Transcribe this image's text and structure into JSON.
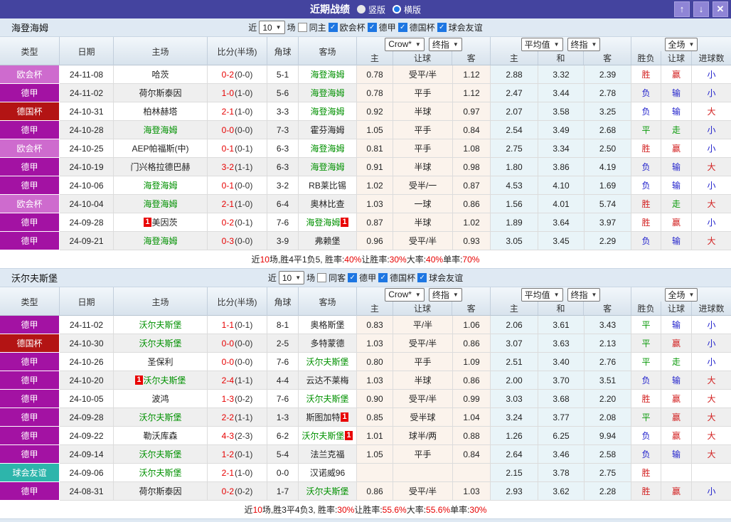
{
  "titlebar": {
    "title": "近期战绩",
    "vertical_label": "竖版",
    "horizontal_label": "横版",
    "up_icon": "↑",
    "down_icon": "↓",
    "close_icon": "✕"
  },
  "controls": {
    "recent_label": "近",
    "recent_value": "10",
    "games_label": "场"
  },
  "columns": {
    "type": "类型",
    "date": "日期",
    "home": "主场",
    "score": "比分(半场)",
    "corner": "角球",
    "away": "客场",
    "odds_home": "主",
    "odds_handicap": "让球",
    "odds_away": "客",
    "avg_home": "主",
    "avg_draw": "和",
    "avg_away": "客",
    "result": "胜负",
    "handicap_result": "让球",
    "goals": "进球数"
  },
  "colors": {
    "titlebar_bg": "#44449f",
    "accent_blue": "#1d76e2",
    "score_red": "#e60000",
    "team_green": "#009100",
    "summary_red": "#e60000",
    "types": {
      "欧会杯": "#ce6bce",
      "德甲": "#a312a3",
      "德国杯": "#b31414",
      "球会友谊": "#2db5ab"
    },
    "outcomes": {
      "胜": "#d21f1f",
      "负": "#2222cc",
      "平": "#0a9a0a",
      "赢": "#d21f1f",
      "输": "#2222cc",
      "走": "#0a9a0a",
      "大": "#d21f1f",
      "小": "#2222cc"
    }
  },
  "tables": [
    {
      "team": "海登海姆",
      "same_filter": "同主",
      "same_checked": false,
      "leagues": [
        "欧会杯",
        "德甲",
        "德国杯",
        "球会友谊"
      ],
      "selects": {
        "odds_source": "Crow*",
        "odds_kind": "终指",
        "avg_source": "平均值",
        "avg_kind": "终指",
        "scope": "全场"
      },
      "rows": [
        {
          "type": "欧会杯",
          "date": "24-11-08",
          "home": "哈茨",
          "home_green": false,
          "home_rc": false,
          "ft": "0-2",
          "ht": "(0-0)",
          "corner": "5-1",
          "away": "海登海姆",
          "away_green": true,
          "away_rc": false,
          "odds": [
            "0.78",
            "受平/半",
            "1.12"
          ],
          "avg": [
            "2.88",
            "3.32",
            "2.39"
          ],
          "result": "胜",
          "hcp": "赢",
          "goals": "小"
        },
        {
          "type": "德甲",
          "date": "24-11-02",
          "home": "荷尔斯泰因",
          "home_green": false,
          "home_rc": false,
          "ft": "1-0",
          "ht": "(1-0)",
          "corner": "5-6",
          "away": "海登海姆",
          "away_green": true,
          "away_rc": false,
          "odds": [
            "0.78",
            "平手",
            "1.12"
          ],
          "avg": [
            "2.47",
            "3.44",
            "2.78"
          ],
          "result": "负",
          "hcp": "输",
          "goals": "小"
        },
        {
          "type": "德国杯",
          "date": "24-10-31",
          "home": "柏林赫塔",
          "home_green": false,
          "home_rc": false,
          "ft": "2-1",
          "ht": "(1-0)",
          "corner": "3-3",
          "away": "海登海姆",
          "away_green": true,
          "away_rc": false,
          "odds": [
            "0.92",
            "半球",
            "0.97"
          ],
          "avg": [
            "2.07",
            "3.58",
            "3.25"
          ],
          "result": "负",
          "hcp": "输",
          "goals": "大"
        },
        {
          "type": "德甲",
          "date": "24-10-28",
          "home": "海登海姆",
          "home_green": true,
          "home_rc": false,
          "ft": "0-0",
          "ht": "(0-0)",
          "corner": "7-3",
          "away": "霍芬海姆",
          "away_green": false,
          "away_rc": false,
          "odds": [
            "1.05",
            "平手",
            "0.84"
          ],
          "avg": [
            "2.54",
            "3.49",
            "2.68"
          ],
          "result": "平",
          "hcp": "走",
          "goals": "小"
        },
        {
          "type": "欧会杯",
          "date": "24-10-25",
          "home": "AEP帕福斯(中)",
          "home_green": false,
          "home_rc": false,
          "ft": "0-1",
          "ht": "(0-1)",
          "corner": "6-3",
          "away": "海登海姆",
          "away_green": true,
          "away_rc": false,
          "odds": [
            "0.81",
            "平手",
            "1.08"
          ],
          "avg": [
            "2.75",
            "3.34",
            "2.50"
          ],
          "result": "胜",
          "hcp": "赢",
          "goals": "小"
        },
        {
          "type": "德甲",
          "date": "24-10-19",
          "home": "门兴格拉德巴赫",
          "home_green": false,
          "home_rc": false,
          "ft": "3-2",
          "ht": "(1-1)",
          "corner": "6-3",
          "away": "海登海姆",
          "away_green": true,
          "away_rc": false,
          "odds": [
            "0.91",
            "半球",
            "0.98"
          ],
          "avg": [
            "1.80",
            "3.86",
            "4.19"
          ],
          "result": "负",
          "hcp": "输",
          "goals": "大"
        },
        {
          "type": "德甲",
          "date": "24-10-06",
          "home": "海登海姆",
          "home_green": true,
          "home_rc": false,
          "ft": "0-1",
          "ht": "(0-0)",
          "corner": "3-2",
          "away": "RB莱比锡",
          "away_green": false,
          "away_rc": false,
          "odds": [
            "1.02",
            "受半/一",
            "0.87"
          ],
          "avg": [
            "4.53",
            "4.10",
            "1.69"
          ],
          "result": "负",
          "hcp": "输",
          "goals": "小"
        },
        {
          "type": "欧会杯",
          "date": "24-10-04",
          "home": "海登海姆",
          "home_green": true,
          "home_rc": false,
          "ft": "2-1",
          "ht": "(1-0)",
          "corner": "6-4",
          "away": "奥林比查",
          "away_green": false,
          "away_rc": false,
          "odds": [
            "1.03",
            "一球",
            "0.86"
          ],
          "avg": [
            "1.56",
            "4.01",
            "5.74"
          ],
          "result": "胜",
          "hcp": "走",
          "goals": "大"
        },
        {
          "type": "德甲",
          "date": "24-09-28",
          "home": "美因茨",
          "home_green": false,
          "home_rc": true,
          "ft": "0-2",
          "ht": "(0-1)",
          "corner": "7-6",
          "away": "海登海姆",
          "away_green": true,
          "away_rc": true,
          "odds": [
            "0.87",
            "半球",
            "1.02"
          ],
          "avg": [
            "1.89",
            "3.64",
            "3.97"
          ],
          "result": "胜",
          "hcp": "赢",
          "goals": "小"
        },
        {
          "type": "德甲",
          "date": "24-09-21",
          "home": "海登海姆",
          "home_green": true,
          "home_rc": false,
          "ft": "0-3",
          "ht": "(0-0)",
          "corner": "3-9",
          "away": "弗赖堡",
          "away_green": false,
          "away_rc": false,
          "odds": [
            "0.96",
            "受平/半",
            "0.93"
          ],
          "avg": [
            "3.05",
            "3.45",
            "2.29"
          ],
          "result": "负",
          "hcp": "输",
          "goals": "大"
        }
      ],
      "summary": [
        [
          "近",
          "k"
        ],
        [
          "10",
          "r"
        ],
        [
          "场,胜4平1负5, 胜率:",
          "k"
        ],
        [
          "40%",
          "r"
        ],
        [
          " 让胜率:",
          "k"
        ],
        [
          "30%",
          "r"
        ],
        [
          " 大率:",
          "k"
        ],
        [
          "40%",
          "r"
        ],
        [
          " 单率:",
          "k"
        ],
        [
          "70%",
          "r"
        ]
      ]
    },
    {
      "team": "沃尔夫斯堡",
      "same_filter": "同客",
      "same_checked": false,
      "leagues": [
        "德甲",
        "德国杯",
        "球会友谊"
      ],
      "selects": {
        "odds_source": "Crow*",
        "odds_kind": "终指",
        "avg_source": "平均值",
        "avg_kind": "终指",
        "scope": "全场"
      },
      "rows": [
        {
          "type": "德甲",
          "date": "24-11-02",
          "home": "沃尔夫斯堡",
          "home_green": true,
          "home_rc": false,
          "ft": "1-1",
          "ht": "(0-1)",
          "corner": "8-1",
          "away": "奥格斯堡",
          "away_green": false,
          "away_rc": false,
          "odds": [
            "0.83",
            "平/半",
            "1.06"
          ],
          "avg": [
            "2.06",
            "3.61",
            "3.43"
          ],
          "result": "平",
          "hcp": "输",
          "goals": "小"
        },
        {
          "type": "德国杯",
          "date": "24-10-30",
          "home": "沃尔夫斯堡",
          "home_green": true,
          "home_rc": false,
          "ft": "0-0",
          "ht": "(0-0)",
          "corner": "2-5",
          "away": "多特蒙德",
          "away_green": false,
          "away_rc": false,
          "odds": [
            "1.03",
            "受平/半",
            "0.86"
          ],
          "avg": [
            "3.07",
            "3.63",
            "2.13"
          ],
          "result": "平",
          "hcp": "赢",
          "goals": "小"
        },
        {
          "type": "德甲",
          "date": "24-10-26",
          "home": "圣保利",
          "home_green": false,
          "home_rc": false,
          "ft": "0-0",
          "ht": "(0-0)",
          "corner": "7-6",
          "away": "沃尔夫斯堡",
          "away_green": true,
          "away_rc": false,
          "odds": [
            "0.80",
            "平手",
            "1.09"
          ],
          "avg": [
            "2.51",
            "3.40",
            "2.76"
          ],
          "result": "平",
          "hcp": "走",
          "goals": "小"
        },
        {
          "type": "德甲",
          "date": "24-10-20",
          "home": "沃尔夫斯堡",
          "home_green": true,
          "home_rc": true,
          "ft": "2-4",
          "ht": "(1-1)",
          "corner": "4-4",
          "away": "云达不莱梅",
          "away_green": false,
          "away_rc": false,
          "odds": [
            "1.03",
            "半球",
            "0.86"
          ],
          "avg": [
            "2.00",
            "3.70",
            "3.51"
          ],
          "result": "负",
          "hcp": "输",
          "goals": "大"
        },
        {
          "type": "德甲",
          "date": "24-10-05",
          "home": "波鸿",
          "home_green": false,
          "home_rc": false,
          "ft": "1-3",
          "ht": "(0-2)",
          "corner": "7-6",
          "away": "沃尔夫斯堡",
          "away_green": true,
          "away_rc": false,
          "odds": [
            "0.90",
            "受平/半",
            "0.99"
          ],
          "avg": [
            "3.03",
            "3.68",
            "2.20"
          ],
          "result": "胜",
          "hcp": "赢",
          "goals": "大"
        },
        {
          "type": "德甲",
          "date": "24-09-28",
          "home": "沃尔夫斯堡",
          "home_green": true,
          "home_rc": false,
          "ft": "2-2",
          "ht": "(1-1)",
          "corner": "1-3",
          "away": "斯图加特",
          "away_green": false,
          "away_rc": true,
          "odds": [
            "0.85",
            "受半球",
            "1.04"
          ],
          "avg": [
            "3.24",
            "3.77",
            "2.08"
          ],
          "result": "平",
          "hcp": "赢",
          "goals": "大"
        },
        {
          "type": "德甲",
          "date": "24-09-22",
          "home": "勒沃库森",
          "home_green": false,
          "home_rc": false,
          "ft": "4-3",
          "ht": "(2-3)",
          "corner": "6-2",
          "away": "沃尔夫斯堡",
          "away_green": true,
          "away_rc": true,
          "odds": [
            "1.01",
            "球半/两",
            "0.88"
          ],
          "avg": [
            "1.26",
            "6.25",
            "9.94"
          ],
          "result": "负",
          "hcp": "赢",
          "goals": "大"
        },
        {
          "type": "德甲",
          "date": "24-09-14",
          "home": "沃尔夫斯堡",
          "home_green": true,
          "home_rc": false,
          "ft": "1-2",
          "ht": "(0-1)",
          "corner": "5-4",
          "away": "法兰克福",
          "away_green": false,
          "away_rc": false,
          "odds": [
            "1.05",
            "平手",
            "0.84"
          ],
          "avg": [
            "2.64",
            "3.46",
            "2.58"
          ],
          "result": "负",
          "hcp": "输",
          "goals": "大"
        },
        {
          "type": "球会友谊",
          "date": "24-09-06",
          "home": "沃尔夫斯堡",
          "home_green": true,
          "home_rc": false,
          "ft": "2-1",
          "ht": "(1-0)",
          "corner": "0-0",
          "away": "汉诺威96",
          "away_green": false,
          "away_rc": false,
          "odds": [
            "",
            "",
            ""
          ],
          "avg": [
            "2.15",
            "3.78",
            "2.75"
          ],
          "result": "胜",
          "hcp": "",
          "goals": ""
        },
        {
          "type": "德甲",
          "date": "24-08-31",
          "home": "荷尔斯泰因",
          "home_green": false,
          "home_rc": false,
          "ft": "0-2",
          "ht": "(0-2)",
          "corner": "1-7",
          "away": "沃尔夫斯堡",
          "away_green": true,
          "away_rc": false,
          "odds": [
            "0.86",
            "受平/半",
            "1.03"
          ],
          "avg": [
            "2.93",
            "3.62",
            "2.28"
          ],
          "result": "胜",
          "hcp": "赢",
          "goals": "小"
        }
      ],
      "summary": [
        [
          "近",
          "k"
        ],
        [
          "10",
          "r"
        ],
        [
          "场,胜3平4负3, 胜率:",
          "k"
        ],
        [
          "30%",
          "r"
        ],
        [
          " 让胜率:",
          "k"
        ],
        [
          "55.6%",
          "r"
        ],
        [
          " 大率:",
          "k"
        ],
        [
          "55.6%",
          "r"
        ],
        [
          " 单率:",
          "k"
        ],
        [
          "30%",
          "r"
        ]
      ]
    }
  ]
}
